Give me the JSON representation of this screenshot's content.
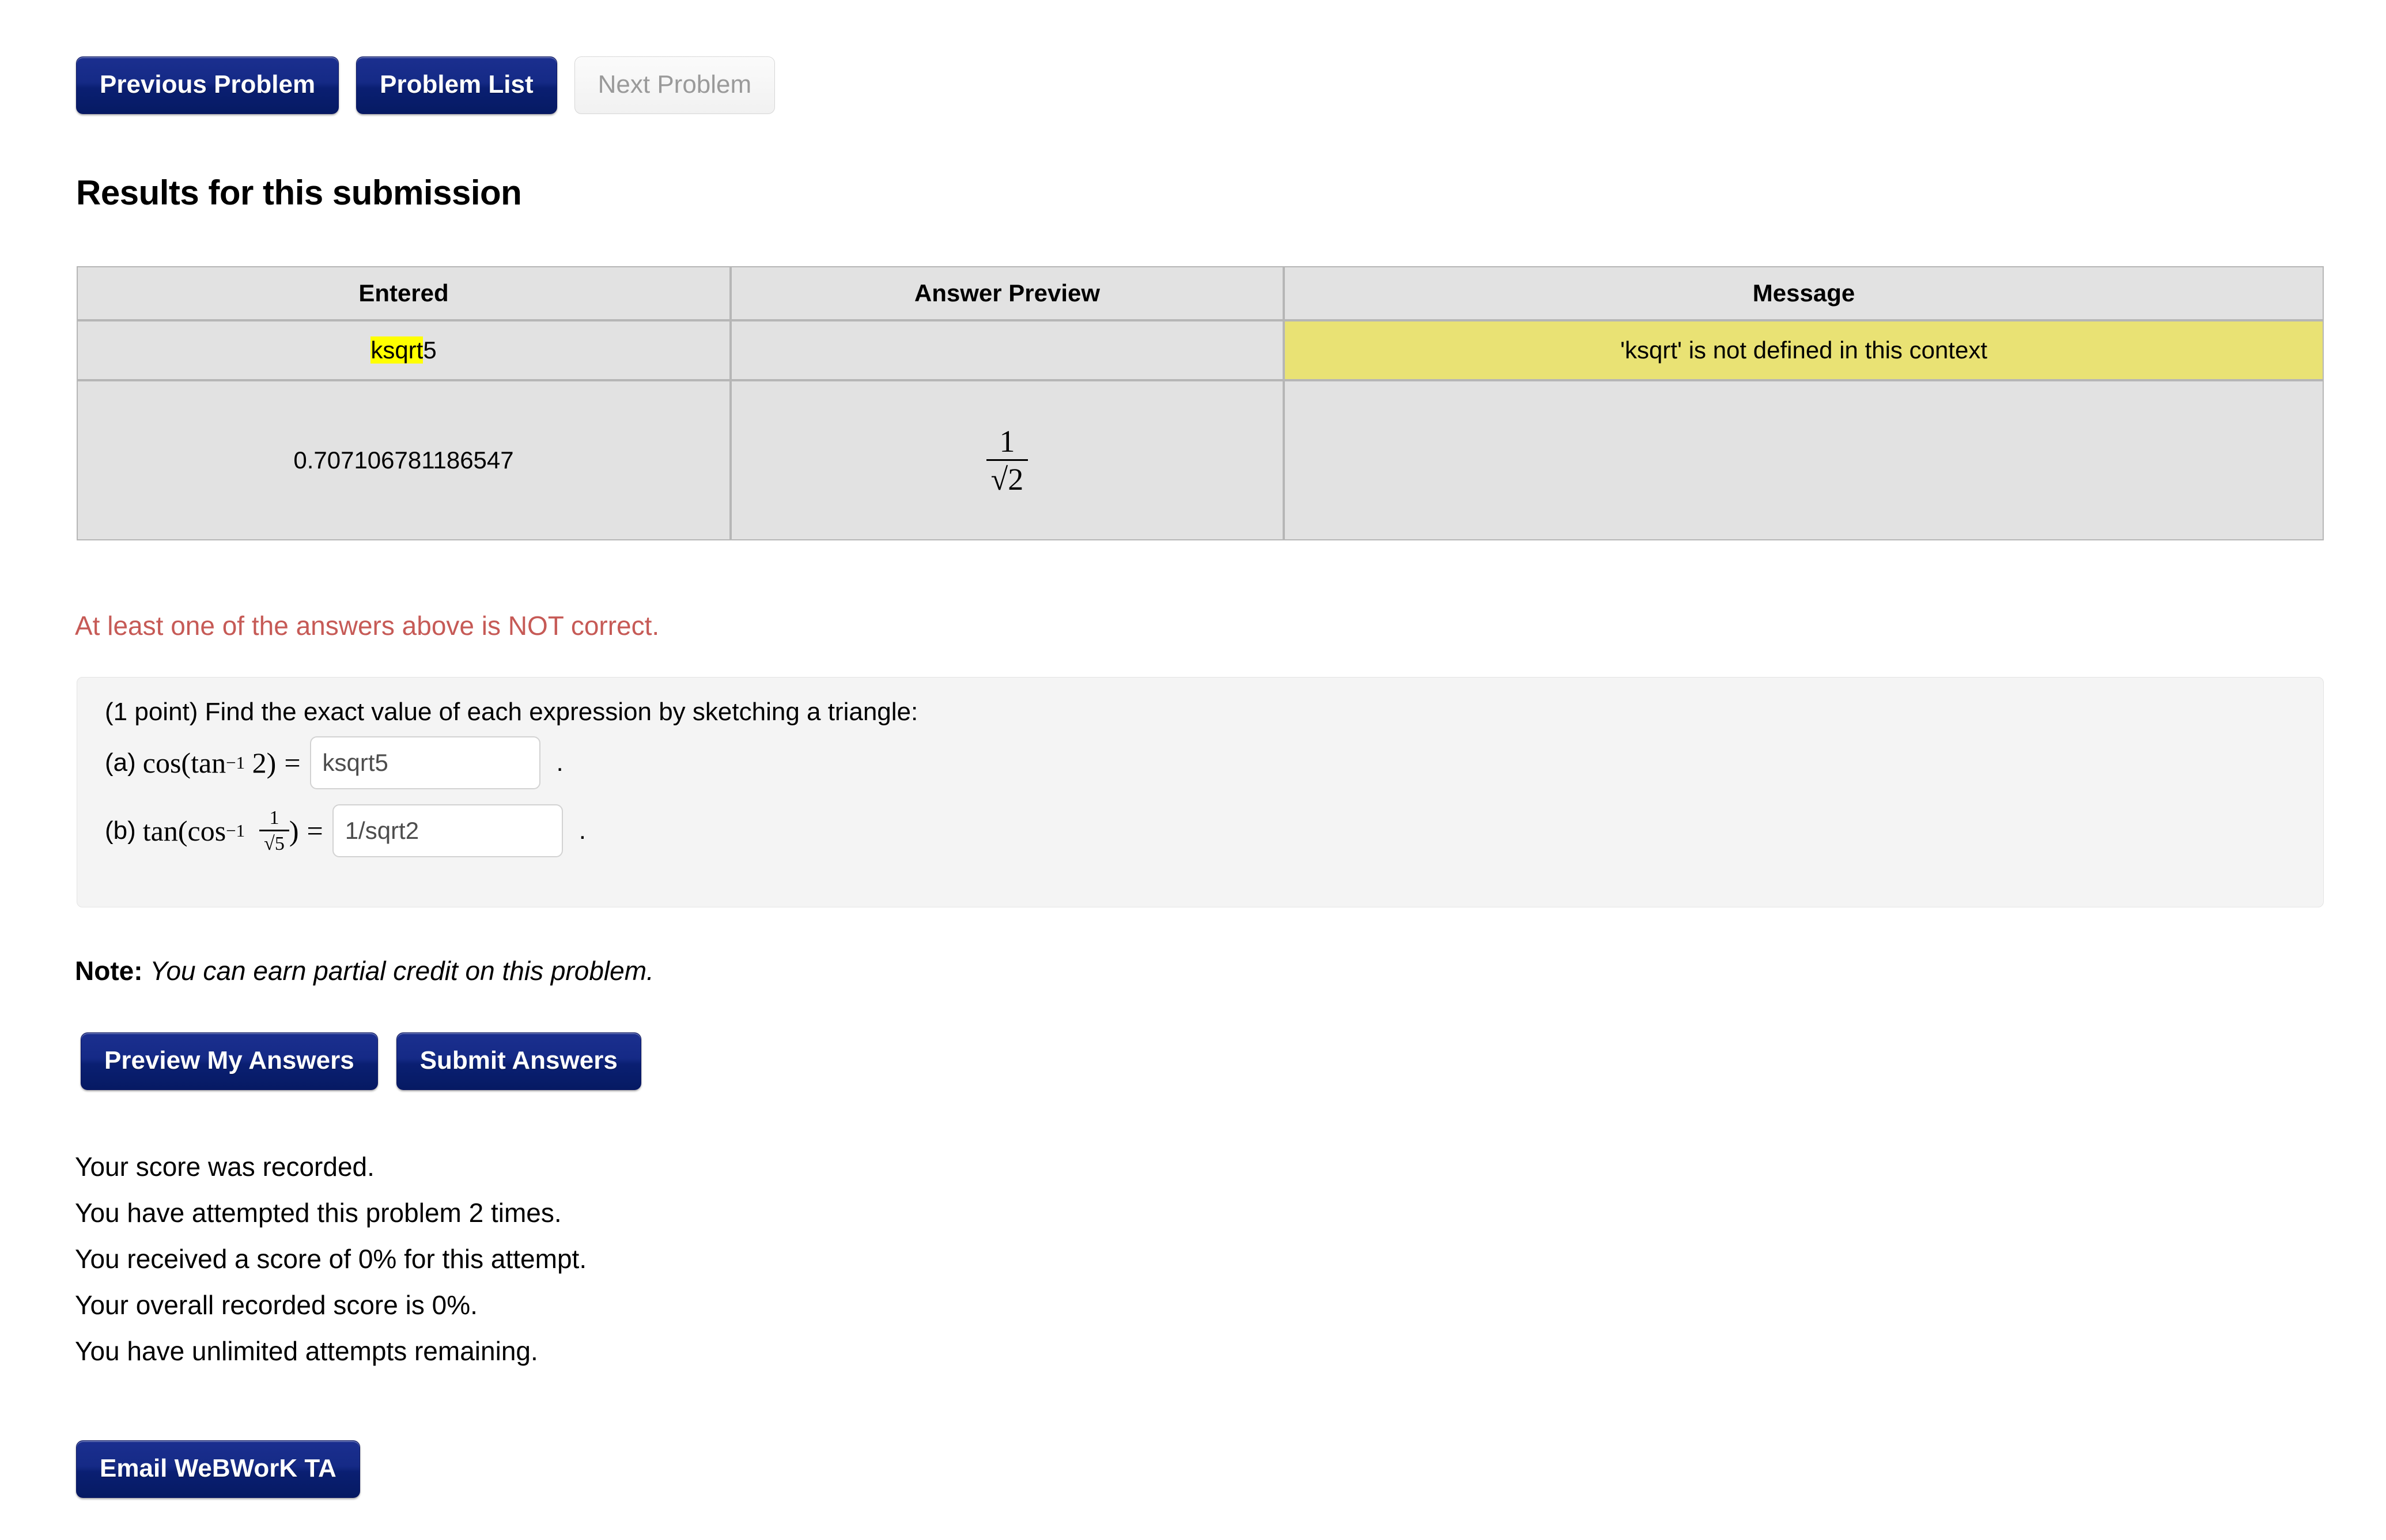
{
  "nav": {
    "previous_problem": "Previous Problem",
    "problem_list": "Problem List",
    "next_problem": "Next Problem"
  },
  "results": {
    "heading": "Results for this submission",
    "columns": [
      "Entered",
      "Answer Preview",
      "Message"
    ],
    "rows": [
      {
        "entered_highlight": "ksqrt",
        "entered_rest": "5",
        "preview": "",
        "message": "'ksqrt' is not defined in this context",
        "message_warning": true
      },
      {
        "entered": "0.707106781186547",
        "preview_numerator": "1",
        "preview_denominator": "√2",
        "message": "",
        "message_warning": false
      }
    ],
    "error_text": "At least one of the answers above is NOT correct."
  },
  "problem": {
    "intro": "(1 point) Find the exact value of each expression by sketching a triangle:",
    "parts": [
      {
        "label": "(a)",
        "expression_prefix": "cos(tan",
        "expression_exponent": "−1",
        "expression_arg": "2",
        "expression_suffix": ")",
        "equals": "=",
        "value": "ksqrt5",
        "placeholder": "",
        "trailing": "."
      },
      {
        "label": "(b)",
        "expression_prefix": "tan(cos",
        "expression_exponent": "−1",
        "fraction_numerator": "1",
        "fraction_denominator": "√5",
        "expression_suffix": ")",
        "equals": "=",
        "value": "1/sqrt2",
        "placeholder": "",
        "trailing": "."
      }
    ]
  },
  "note": {
    "label": "Note:",
    "text": "You can earn partial credit on this problem."
  },
  "actions": {
    "preview": "Preview My Answers",
    "submit": "Submit Answers"
  },
  "score": {
    "lines": [
      "Your score was recorded.",
      "You have attempted this problem 2 times.",
      "You received a score of 0% for this attempt.",
      "Your overall recorded score is 0%.",
      "You have unlimited attempts remaining."
    ]
  },
  "footer": {
    "email_ta": "Email WeBWorK TA"
  },
  "colors": {
    "button_blue": "#152a86",
    "warning_yellow": "#e9e274",
    "highlight_yellow": "#ffff00",
    "error_red": "#c65a56",
    "table_cell": "#e2e2e2",
    "panel_gray": "#f4f4f4"
  }
}
